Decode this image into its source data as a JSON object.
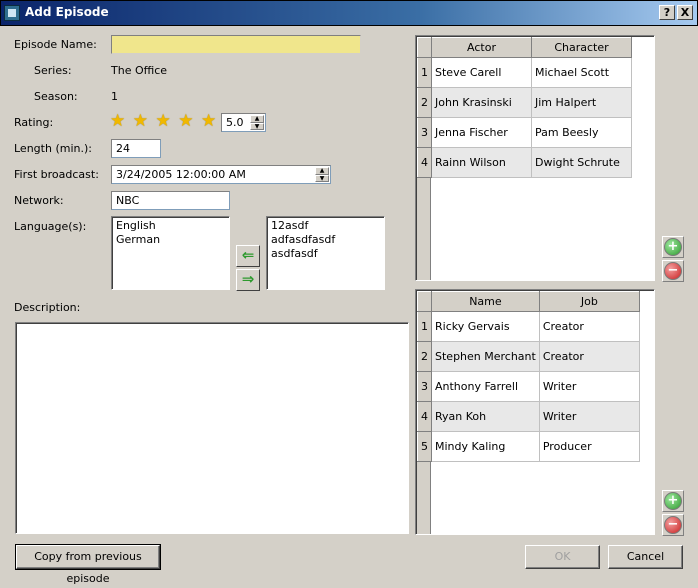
{
  "window": {
    "title": "Add Episode",
    "help_btn": "?",
    "close_btn": "X"
  },
  "form": {
    "episode_name_label": "Episode Name:",
    "episode_name_value": "",
    "series_label": "Series:",
    "series_value": "The Office",
    "season_label": "Season:",
    "season_value": "1",
    "rating_label": "Rating:",
    "rating_value": "5.0",
    "rating_stars": 5,
    "length_label": "Length (min.):",
    "length_value": "24",
    "broadcast_label": "First broadcast:",
    "broadcast_value": "3/24/2005 12:00:00 AM",
    "network_label": "Network:",
    "network_value": "NBC",
    "language_label": "Language(s):",
    "languages_selected": [
      "English",
      "German"
    ],
    "languages_available": [
      "12asdf",
      "adfasdfasdf",
      "asdfasdf"
    ],
    "description_label": "Description:",
    "description_value": ""
  },
  "cast_table": {
    "headers": [
      "Actor",
      "Character"
    ],
    "rows": [
      [
        "1",
        "Steve Carell",
        "Michael Scott"
      ],
      [
        "2",
        "John Krasinski",
        "Jim Halpert"
      ],
      [
        "3",
        "Jenna Fischer",
        "Pam Beesly"
      ],
      [
        "4",
        "Rainn Wilson",
        "Dwight Schrute"
      ]
    ]
  },
  "crew_table": {
    "headers": [
      "Name",
      "Job"
    ],
    "rows": [
      [
        "1",
        "Ricky Gervais",
        "Creator"
      ],
      [
        "2",
        "Stephen Merchant",
        "Creator"
      ],
      [
        "3",
        "Anthony Farrell",
        "Writer"
      ],
      [
        "4",
        "Ryan Koh",
        "Writer"
      ],
      [
        "5",
        "Mindy Kaling",
        "Producer"
      ]
    ]
  },
  "buttons": {
    "copy_prev": "Copy from previous episode",
    "ok": "OK",
    "cancel": "Cancel"
  },
  "icons": {
    "move_left": "arrow-left-icon",
    "move_right": "arrow-right-icon",
    "add": "plus-icon",
    "remove": "minus-icon"
  }
}
